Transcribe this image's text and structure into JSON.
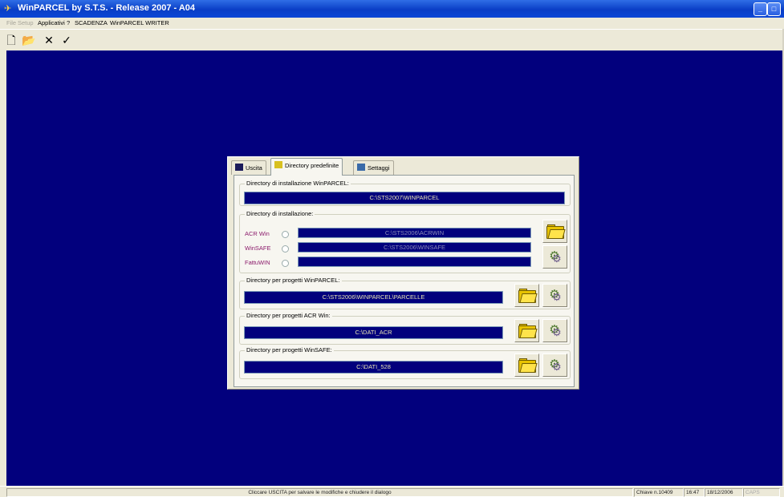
{
  "window": {
    "title": "WinPARCEL by S.T.S. - Release 2007 - A04",
    "min_glyph": "_",
    "max_glyph": "□"
  },
  "menu": {
    "items": [
      "File",
      "Setup",
      "Applicativi",
      "?",
      "SCADENZA",
      "WinPARCEL WRITER"
    ]
  },
  "toolbar": {
    "new_glyph": "🗋",
    "open_glyph": "📂",
    "delete_glyph": "✕",
    "confirm_glyph": "✓"
  },
  "dialog": {
    "tabs": [
      "Uscita",
      "Directory predefinite",
      "Settaggi"
    ],
    "active_tab": "Directory predefinite",
    "install_group": {
      "label": "Directory di installazione WinPARCEL:",
      "path": "C:\\STS2007\\WINPARCEL"
    },
    "apps_group": {
      "label": "Directory di installazione:",
      "rows": [
        {
          "name": "ACR Win",
          "path": "C:\\STS2006\\ACRWIN"
        },
        {
          "name": "WinSAFE",
          "path": "C:\\STS2006\\WINSAFE"
        },
        {
          "name": "FattuWIN",
          "path": ""
        }
      ]
    },
    "projects_winparcel": {
      "label": "Directory per progetti WinPARCEL:",
      "path": "C:\\STS2006\\WINPARCEL\\PARCELLE"
    },
    "projects_acr": {
      "label": "Directory per progetti ACR Win:",
      "path": "C:\\DATI_ACR"
    },
    "projects_winsafe": {
      "label": "Directory per progetti WinSAFE:",
      "path": "C:\\DATI_528"
    }
  },
  "statusbar": {
    "message": "Cliccare USCITA per salvare le modifiche e chiudere il dialogo",
    "field1": "Chiave n.10409",
    "time": "16:47",
    "date": "18/12/2006",
    "mode": "CAPS"
  }
}
